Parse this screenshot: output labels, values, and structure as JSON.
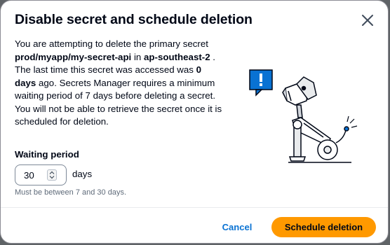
{
  "dialog": {
    "title": "Disable secret and schedule deletion",
    "close_icon": "close-icon"
  },
  "message": {
    "part1": "You are attempting to delete the primary secret ",
    "secret_name": "prod/myapp/my-secret-api",
    "part2": " in ",
    "region": "ap-southeast-2",
    "part3": " . The last time this secret was accessed was ",
    "last_accessed": "0 days",
    "part4": " ago. Secrets Manager requires a minimum waiting period of 7 days before deleting a secret. You will not be able to retrieve the secret once it is scheduled for deletion."
  },
  "waiting_period": {
    "label": "Waiting period",
    "value": "30",
    "unit": "days",
    "hint": "Must be between 7 and 30 days."
  },
  "footer": {
    "cancel_label": "Cancel",
    "schedule_label": "Schedule deletion"
  },
  "colors": {
    "primary_button": "#ff9900",
    "link": "#0972d3",
    "text": "#000716",
    "illustration_accent": "#0972d3"
  },
  "illustration": {
    "icon": "robot-dog-warning-illustration"
  }
}
